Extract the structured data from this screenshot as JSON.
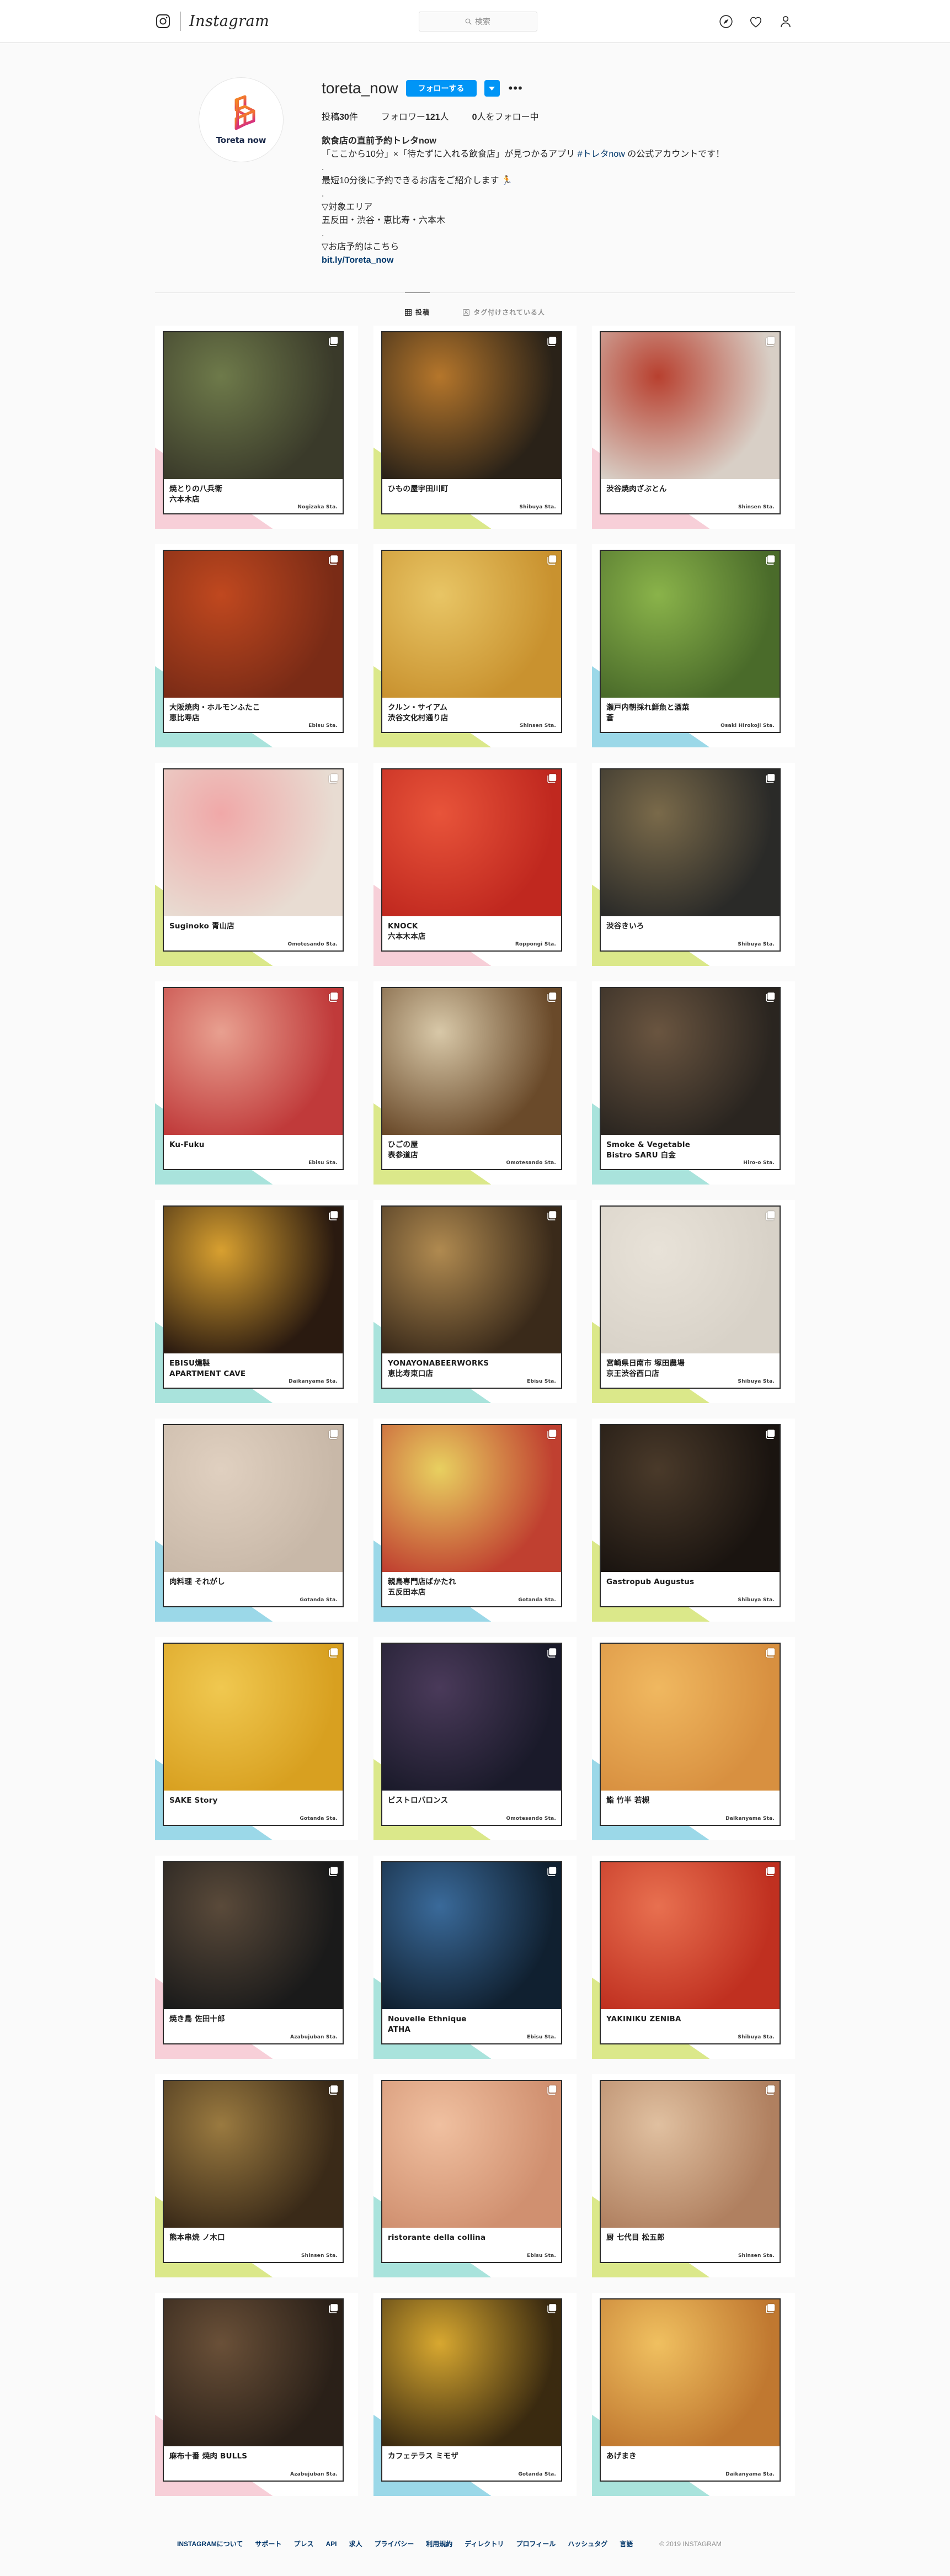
{
  "nav": {
    "logo_icon": "instagram-camera-icon",
    "wordmark": "Instagram",
    "search": {
      "placeholder": "検索",
      "value": "",
      "icon": "search-icon"
    },
    "icons": [
      {
        "name": "compass-icon",
        "label": "発見"
      },
      {
        "name": "heart-icon",
        "label": "アクティビティ"
      },
      {
        "name": "person-icon",
        "label": "プロフィール"
      }
    ]
  },
  "profile": {
    "avatar_label": "Toreta now",
    "username": "toreta_now",
    "follow_label": "フォローする",
    "caret_icon": "chevron-down-icon",
    "more_icon": "more-options-icon",
    "stats": {
      "posts_prefix": "投稿",
      "posts_count": "30",
      "posts_suffix": "件",
      "followers_prefix": "フォロワー",
      "followers_count": "121",
      "followers_suffix": "人",
      "following_count": "0",
      "following_suffix": "人をフォロー中"
    },
    "bio": {
      "title": "飲食店の直前予約トレタnow",
      "line1_a": "「ここから10分」×「待たずに入れる飲食店」が見つかるアプリ ",
      "line1_tag": "#トレタnow",
      "line1_b": " の公式アカウントです！",
      "dot1": ".",
      "line2": "最短10分後に予約できるお店をご紹介します 🏃",
      "dot2": ".",
      "line3": "▽対象エリア",
      "line4": "五反田・渋谷・恵比寿・六本木",
      "dot3": ".",
      "line5": "▽お店予約はこちら",
      "link": "bit.ly/Toreta_now"
    }
  },
  "tabs": [
    {
      "label": "投稿",
      "icon": "grid-icon",
      "active": true
    },
    {
      "label": "タグ付けされている人",
      "icon": "tagged-person-icon",
      "active": false
    }
  ],
  "posts": [
    {
      "name": "焼とりの八兵衛",
      "name2": "六本木店",
      "station": "Nogizaka Sta.",
      "accent": "#f7cfd8",
      "photo_a": "#3a3a2a",
      "photo_b": "#6e7a4a",
      "carousel": true
    },
    {
      "name": "ひもの屋宇田川町",
      "name2": "",
      "station": "Shibuya Sta.",
      "accent": "#dbe88a",
      "photo_a": "#2a2218",
      "photo_b": "#b5762b",
      "carousel": true
    },
    {
      "name": "渋谷焼肉ざぶとん",
      "name2": "",
      "station": "Shinsen Sta.",
      "accent": "#f7cfd8",
      "photo_a": "#d8cfc6",
      "photo_b": "#b8402f",
      "carousel": true
    },
    {
      "name": "大阪焼肉・ホルモンふたこ",
      "name2": "恵比寿店",
      "station": "Ebisu Sta.",
      "accent": "#a9e3dc",
      "photo_a": "#7a2b16",
      "photo_b": "#c0481f",
      "carousel": true
    },
    {
      "name": "クルン・サイアム",
      "name2": "渋谷文化村通り店",
      "station": "Shinsen Sta.",
      "accent": "#dbe88a",
      "photo_a": "#c9922f",
      "photo_b": "#e8c565",
      "carousel": true
    },
    {
      "name": "瀬戸内朝採れ鮮魚と酒菜",
      "name2": "蒼",
      "station": "Osaki Hirokoji Sta.",
      "accent": "#9bd8e8",
      "photo_a": "#4a6b2a",
      "photo_b": "#8ab34a",
      "carousel": true
    },
    {
      "name": "Suginoko 青山店",
      "name2": "",
      "station": "Omotesando Sta.",
      "accent": "#dbe88a",
      "photo_a": "#e8dcd2",
      "photo_b": "#f0a8a8",
      "carousel": true
    },
    {
      "name": "KNOCK",
      "name2": "六本木本店",
      "station": "Roppongi Sta.",
      "accent": "#f7cfd8",
      "photo_a": "#c0281f",
      "photo_b": "#e8543a",
      "carousel": true
    },
    {
      "name": "渋谷きいろ",
      "name2": "",
      "station": "Shibuya Sta.",
      "accent": "#dbe88a",
      "photo_a": "#2a2a28",
      "photo_b": "#7a6a4a",
      "carousel": true
    },
    {
      "name": "Ku-Fuku",
      "name2": "",
      "station": "Ebisu Sta.",
      "accent": "#a9e3dc",
      "photo_a": "#c03a3a",
      "photo_b": "#e8a090",
      "carousel": true
    },
    {
      "name": "ひごの屋",
      "name2": "表参道店",
      "station": "Omotesando Sta.",
      "accent": "#dbe88a",
      "photo_a": "#6a4a2a",
      "photo_b": "#d8c8a8",
      "carousel": true
    },
    {
      "name": "Smoke & Vegetable",
      "name2": "Bistro SARU 白金",
      "station": "Hiro-o Sta.",
      "accent": "#a9e3dc",
      "photo_a": "#2a2520",
      "photo_b": "#6a5540",
      "carousel": true
    },
    {
      "name": "EBISU燻製",
      "name2": "APARTMENT CAVE",
      "station": "Daikanyama Sta.",
      "accent": "#a9e3dc",
      "photo_a": "#2a1a10",
      "photo_b": "#d8a030",
      "carousel": true
    },
    {
      "name": "YONAYONABEERWORKS",
      "name2": "恵比寿東口店",
      "station": "Ebisu Sta.",
      "accent": "#a9e3dc",
      "photo_a": "#3a2a1a",
      "photo_b": "#b08a50",
      "carousel": true
    },
    {
      "name": "宮崎県日南市 塚田農場",
      "name2": "京王渋谷西口店",
      "station": "Shibuya Sta.",
      "accent": "#dbe88a",
      "photo_a": "#d8d2c8",
      "photo_b": "#e8e2d8",
      "carousel": true
    },
    {
      "name": "肉料理 それがし",
      "name2": "",
      "station": "Gotanda Sta.",
      "accent": "#9bd8e8",
      "photo_a": "#c8b8a8",
      "photo_b": "#e0d0c0",
      "carousel": true
    },
    {
      "name": "親鳥専門店ばかたれ",
      "name2": "五反田本店",
      "station": "Gotanda Sta.",
      "accent": "#9bd8e8",
      "photo_a": "#c04030",
      "photo_b": "#e8d060",
      "carousel": true
    },
    {
      "name": "Gastropub Augustus",
      "name2": "",
      "station": "Shibuya Sta.",
      "accent": "#dbe88a",
      "photo_a": "#1a1410",
      "photo_b": "#4a3a2a",
      "carousel": true
    },
    {
      "name": "SAKE Story",
      "name2": "",
      "station": "Gotanda Sta.",
      "accent": "#9bd8e8",
      "photo_a": "#d8a020",
      "photo_b": "#f0c850",
      "carousel": true
    },
    {
      "name": "ビストロバロンス",
      "name2": "",
      "station": "Omotesando Sta.",
      "accent": "#dbe88a",
      "photo_a": "#1a1a2a",
      "photo_b": "#4a3a5a",
      "carousel": true
    },
    {
      "name": "鮨 竹半 若槻",
      "name2": "",
      "station": "Daikanyama Sta.",
      "accent": "#9bd8e8",
      "photo_a": "#d89040",
      "photo_b": "#f0b860",
      "carousel": true
    },
    {
      "name": "焼き鳥 佐田十郎",
      "name2": "",
      "station": "Azabujuban Sta.",
      "accent": "#f7cfd8",
      "photo_a": "#1a1a1a",
      "photo_b": "#5a4a3a",
      "carousel": true
    },
    {
      "name": "Nouvelle Ethnique",
      "name2": "ATHA",
      "station": "Ebisu Sta.",
      "accent": "#a9e3dc",
      "photo_a": "#102030",
      "photo_b": "#3a6a9a",
      "carousel": true
    },
    {
      "name": "YAKINIKU ZENIBA",
      "name2": "",
      "station": "Shibuya Sta.",
      "accent": "#dbe88a",
      "photo_a": "#c03020",
      "photo_b": "#e87050",
      "carousel": true
    },
    {
      "name": "熊本串焼 ノ木口",
      "name2": "",
      "station": "Shinsen Sta.",
      "accent": "#dbe88a",
      "photo_a": "#3a2a18",
      "photo_b": "#9a7a40",
      "carousel": true
    },
    {
      "name": "ristorante della collina",
      "name2": "",
      "station": "Ebisu Sta.",
      "accent": "#a9e3dc",
      "photo_a": "#d09070",
      "photo_b": "#f0c0a0",
      "carousel": true
    },
    {
      "name": "厨 七代目 松五郎",
      "name2": "",
      "station": "Shinsen Sta.",
      "accent": "#dbe88a",
      "photo_a": "#b08060",
      "photo_b": "#e0c0a0",
      "carousel": true
    },
    {
      "name": "麻布十番 焼肉 BULLS",
      "name2": "",
      "station": "Azabujuban Sta.",
      "accent": "#f7cfd8",
      "photo_a": "#2a2018",
      "photo_b": "#6a5038",
      "carousel": true
    },
    {
      "name": "カフェテラス ミモザ",
      "name2": "",
      "station": "Gotanda Sta.",
      "accent": "#9bd8e8",
      "photo_a": "#3a2a10",
      "photo_b": "#d8a830",
      "carousel": true
    },
    {
      "name": "あげまき",
      "name2": "",
      "station": "Daikanyama Sta.",
      "accent": "#a9e3dc",
      "photo_a": "#c07830",
      "photo_b": "#f0c060",
      "carousel": true
    }
  ],
  "footer": {
    "links": [
      "INSTAGRAMについて",
      "サポート",
      "プレス",
      "API",
      "求人",
      "プライバシー",
      "利用規約",
      "ディレクトリ",
      "プロフィール",
      "ハッシュタグ",
      "言語"
    ],
    "copyright": "© 2019 INSTAGRAM"
  },
  "colors": {
    "accent_blue": "#0095f6",
    "link_blue": "#00376b",
    "footer_link": "#003569",
    "text": "#262626",
    "muted": "#8e8e8e",
    "page_bg": "#fafafa"
  }
}
